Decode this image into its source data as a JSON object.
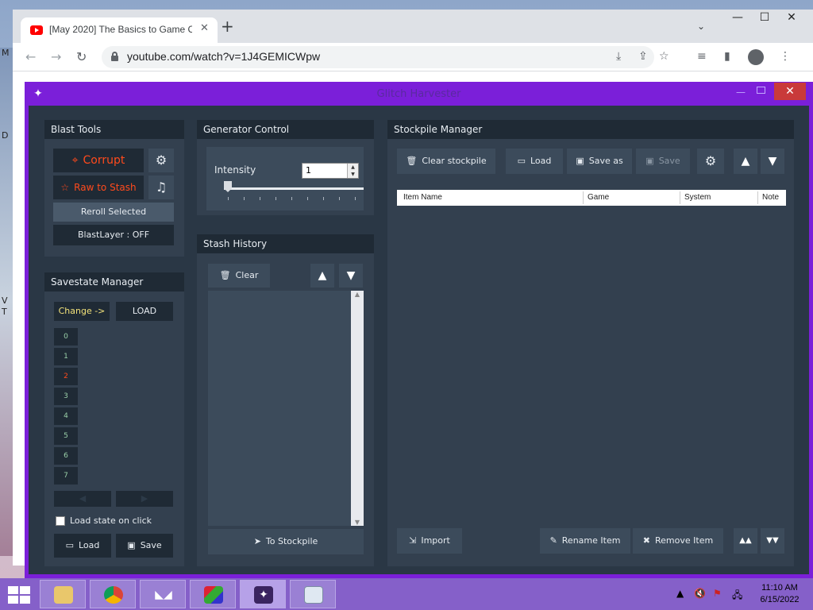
{
  "browser": {
    "tab_title": "[May 2020] The Basics to Game C",
    "tab_close": "✕",
    "new_tab": "+",
    "tab_search": "⌄",
    "url": "youtube.com/watch?v=1J4GEMICWpw",
    "win_min": "—",
    "win_max": "☐",
    "win_close": "✕",
    "back": "←",
    "forward": "→",
    "reload": "↻"
  },
  "gh": {
    "title": "Glitch Harvester",
    "close": "✕",
    "blast_tools": {
      "header": "Blast Tools",
      "corrupt": "Corrupt",
      "raw_to_stash": "Raw to Stash",
      "reroll": "Reroll Selected",
      "blastlayer": "BlastLayer : OFF"
    },
    "savestate": {
      "header": "Savestate Manager",
      "change": "Change ->",
      "load_top": "LOAD",
      "slots": [
        "0",
        "1",
        "2",
        "3",
        "4",
        "5",
        "6",
        "7"
      ],
      "active_slot": "2",
      "prev": "◀",
      "next": "▶",
      "load_on_click": "Load state on click",
      "load": "Load",
      "save": "Save"
    },
    "generator": {
      "header": "Generator Control",
      "intensity_label": "Intensity",
      "intensity_value": "1"
    },
    "stash": {
      "header": "Stash History",
      "clear": "Clear",
      "to_stockpile": "To Stockpile"
    },
    "stockpile": {
      "header": "Stockpile Manager",
      "clear": "Clear stockpile",
      "load": "Load",
      "save_as": "Save as",
      "save": "Save",
      "columns": [
        "Item Name",
        "Game",
        "System",
        "Note"
      ],
      "import": "Import",
      "rename": "Rename Item",
      "remove": "Remove Item"
    }
  },
  "taskbar": {
    "time": "11:10 AM",
    "date": "6/15/2022"
  },
  "colors": {
    "accent_purple": "#7b1fd9",
    "corrupt_red": "#ff4a1c",
    "panel_bg": "#33404f",
    "panel_header": "#1f2a35"
  }
}
